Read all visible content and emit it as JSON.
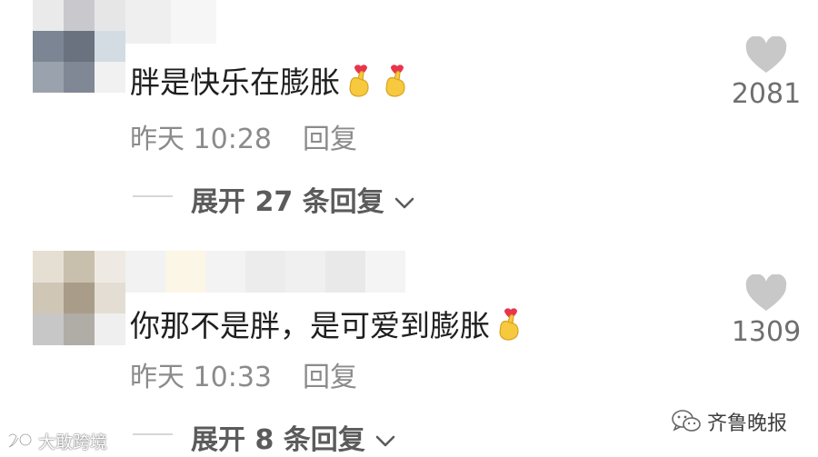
{
  "comments": [
    {
      "text": "胖是快乐在膨胀",
      "emojis": [
        "heart-hand-icon",
        "heart-hand-icon"
      ],
      "time": "昨天 10:28",
      "reply_label": "回复",
      "expand_label": "展开 27 条回复",
      "likes": "2081"
    },
    {
      "text": "你那不是胖，是可爱到膨胀",
      "emojis": [
        "heart-hand-icon"
      ],
      "time": "昨天 10:33",
      "reply_label": "回复",
      "expand_label": "展开 8 条回复",
      "likes": "1309"
    }
  ],
  "watermarks": {
    "left": "大敢跨境",
    "right": "齐鲁晚报"
  },
  "colors": {
    "text": "#1f1f1f",
    "meta": "#8b8b8b",
    "heart": "#c8c8c8",
    "emoji_hand": "#f6c93f",
    "emoji_heart": "#e8354d"
  }
}
